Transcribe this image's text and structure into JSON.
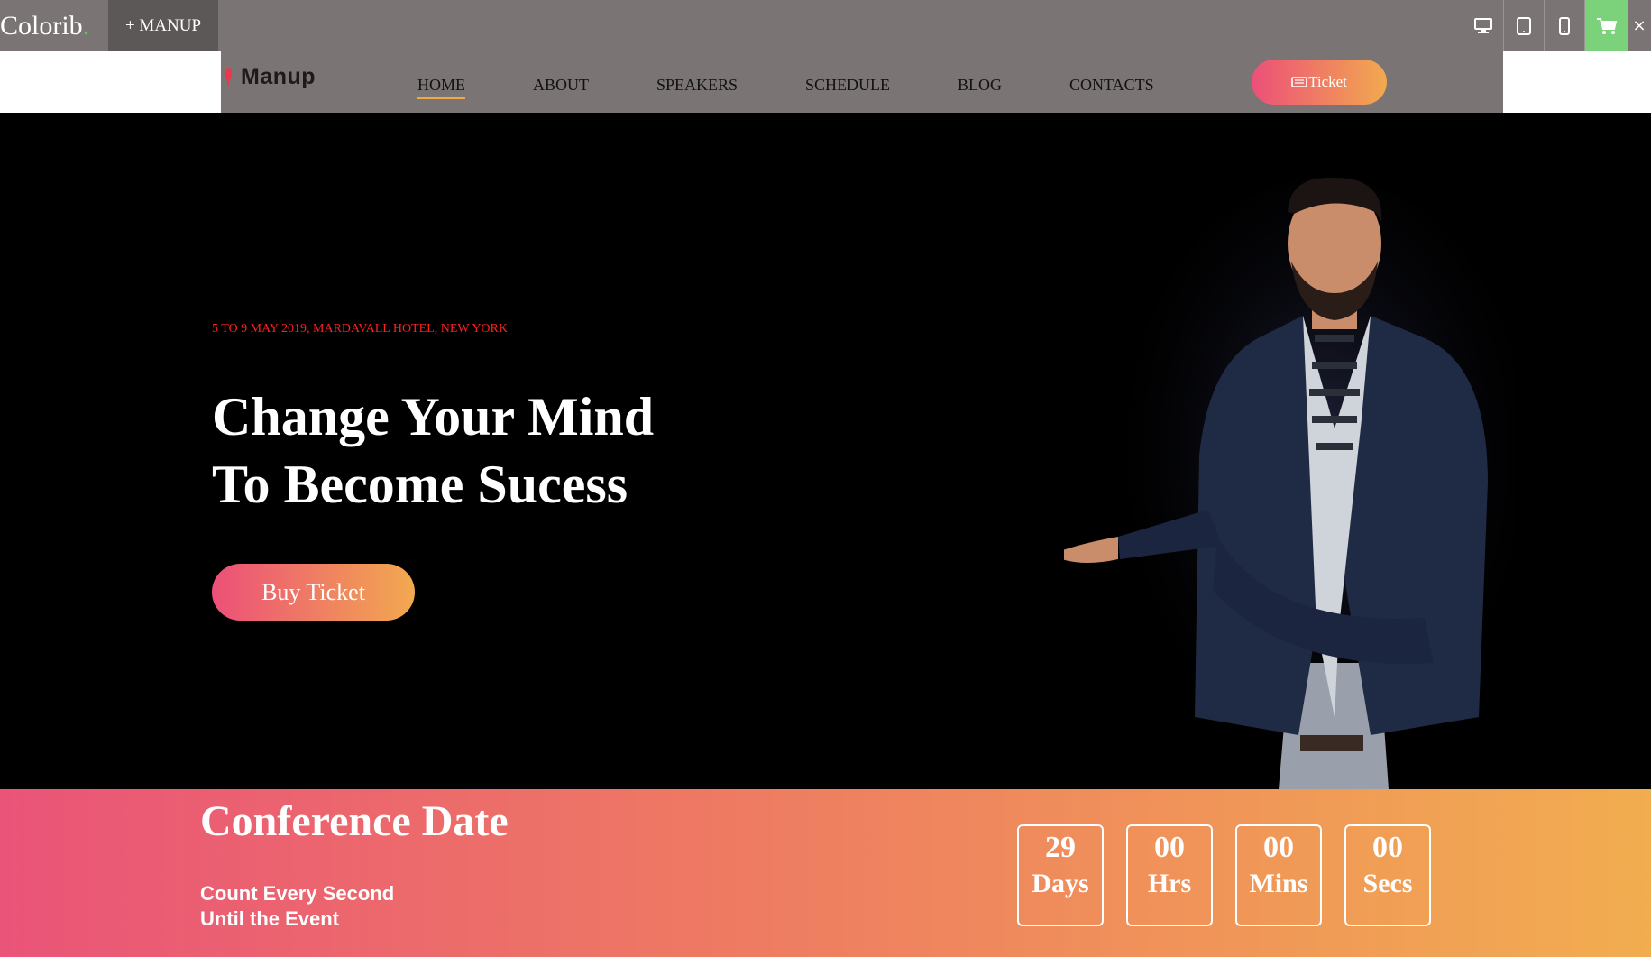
{
  "topbar": {
    "brand": "Colorib",
    "brand_dot": ".",
    "theme_tab": "+ MANUP",
    "device_icons": [
      "desktop-icon",
      "tablet-icon",
      "mobile-icon",
      "cart-icon"
    ],
    "close": "×"
  },
  "nav": {
    "logo": "Manup",
    "items": [
      {
        "label": "HOME",
        "active": true
      },
      {
        "label": "ABOUT"
      },
      {
        "label": "SPEAKERS"
      },
      {
        "label": "SCHEDULE"
      },
      {
        "label": "BLOG"
      },
      {
        "label": "CONTACTS"
      }
    ],
    "ticket_label": "Ticket"
  },
  "hero": {
    "date": "5 TO 9 MAY 2019, MARDAVALL HOTEL, NEW YORK",
    "title_line1": "Change Your Mind",
    "title_line2": "To Become Sucess",
    "cta": "Buy Ticket"
  },
  "countdown": {
    "title": "Conference Date",
    "sub_line1": "Count Every Second",
    "sub_line2": "Until the Event",
    "items": [
      {
        "value": "29",
        "unit": "Days"
      },
      {
        "value": "00",
        "unit": "Hrs"
      },
      {
        "value": "00",
        "unit": "Mins"
      },
      {
        "value": "00",
        "unit": "Secs"
      }
    ]
  },
  "colors": {
    "topbar": "#7a7474",
    "accent_start": "#ec5078",
    "accent_end": "#f2a94f",
    "date_red": "#ff1f1f",
    "cart_green": "#7bd27b"
  }
}
